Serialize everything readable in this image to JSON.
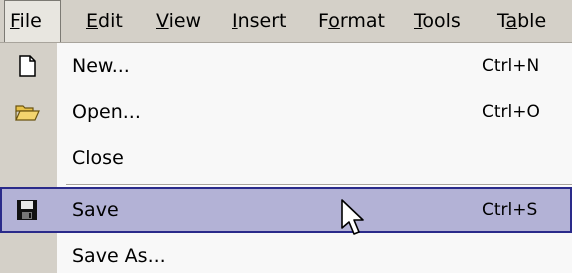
{
  "menubar": {
    "items": [
      {
        "label": "File",
        "mnemonic_index": 0,
        "active": true
      },
      {
        "label": "Edit",
        "mnemonic_index": 0,
        "active": false
      },
      {
        "label": "View",
        "mnemonic_index": 0,
        "active": false
      },
      {
        "label": "Insert",
        "mnemonic_index": 0,
        "active": false
      },
      {
        "label": "Format",
        "mnemonic_index": 1,
        "active": false
      },
      {
        "label": "Tools",
        "mnemonic_index": 0,
        "active": false
      },
      {
        "label": "Table",
        "mnemonic_index": 1,
        "active": false
      }
    ]
  },
  "file_menu": {
    "items": [
      {
        "label": "New...",
        "shortcut": "Ctrl+N",
        "icon": "new-document-icon"
      },
      {
        "label": "Open...",
        "shortcut": "Ctrl+O",
        "icon": "open-folder-icon"
      },
      {
        "label": "Close",
        "shortcut": "",
        "icon": ""
      },
      {
        "label": "Save",
        "shortcut": "Ctrl+S",
        "icon": "floppy-disk-icon",
        "highlighted": true
      },
      {
        "label": "Save As...",
        "shortcut": "",
        "icon": ""
      }
    ]
  },
  "colors": {
    "menu_background": "#d4d0c8",
    "dropdown_background": "#f8f8f8",
    "highlight_background": "#b3b2d6",
    "highlight_border": "#2a2a8a"
  },
  "cursor": {
    "icon": "arrow-cursor-icon"
  }
}
